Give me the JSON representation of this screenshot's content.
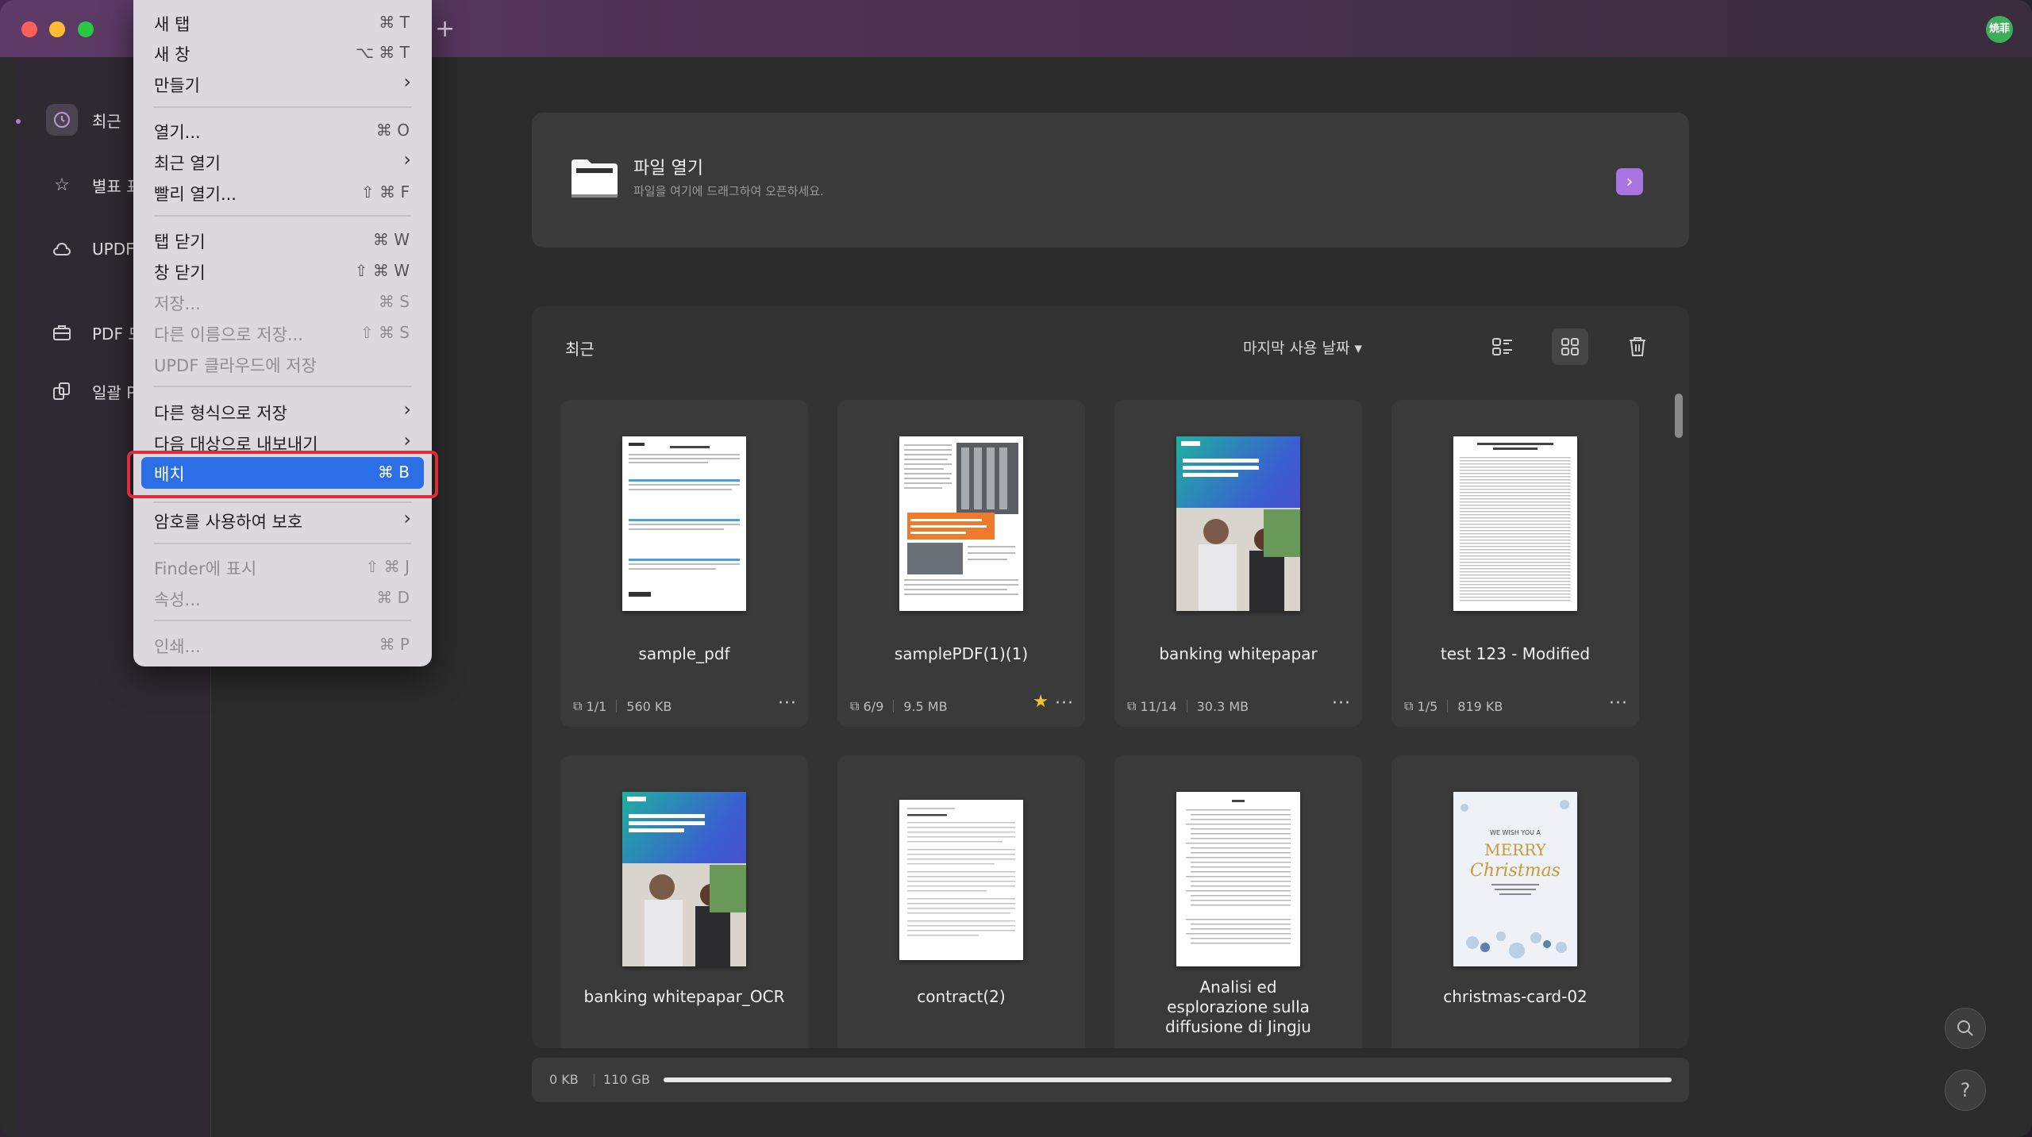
{
  "window": {
    "user_badge": "焼菲"
  },
  "sidebar": {
    "items": [
      {
        "label": "최근",
        "icon": "clock-icon"
      },
      {
        "label": "별표 표",
        "icon": "star-icon"
      },
      {
        "label": "UPDF",
        "icon": "cloud-icon"
      },
      {
        "label": "PDF 도",
        "icon": "briefcase-icon"
      },
      {
        "label": "일괄 P",
        "icon": "batch-icon"
      }
    ]
  },
  "open_file": {
    "title": "파일 열기",
    "subtitle": "파일을 여기에 드래그하여 오픈하세요."
  },
  "recent": {
    "label": "최근",
    "sort_label": "마지막 사용 날짜 ▾",
    "files": [
      {
        "name": "sample_pdf",
        "pages": "1/1",
        "size": "560 KB",
        "starred": false
      },
      {
        "name": "samplePDF(1)(1)",
        "pages": "6/9",
        "size": "9.5 MB",
        "starred": true
      },
      {
        "name": "banking whitepapar",
        "pages": "11/14",
        "size": "30.3 MB",
        "starred": false
      },
      {
        "name": "test 123 - Modified",
        "pages": "1/5",
        "size": "819 KB",
        "starred": false
      },
      {
        "name": "banking whitepapar_OCR"
      },
      {
        "name": "contract(2)"
      },
      {
        "name": "Analisi ed esplorazione sulla diffusione di Jingju"
      },
      {
        "name": "christmas-card-02"
      }
    ]
  },
  "storage": {
    "used": "0 KB",
    "total": "110 GB"
  },
  "menu": {
    "items": [
      {
        "label": "새 탭",
        "shortcut": "⌘ T"
      },
      {
        "label": "새 창",
        "shortcut": "⌥ ⌘ T"
      },
      {
        "label": "만들기",
        "submenu": true
      },
      {
        "label": "열기...",
        "shortcut": "⌘ O"
      },
      {
        "label": "최근 열기",
        "submenu": true
      },
      {
        "label": "빨리 열기...",
        "shortcut": "⇧ ⌘ F"
      },
      {
        "label": "탭 닫기",
        "shortcut": "⌘ W"
      },
      {
        "label": "창 닫기",
        "shortcut": "⇧ ⌘ W"
      },
      {
        "label": "저장...",
        "shortcut": "⌘ S",
        "disabled": true
      },
      {
        "label": "다른 이름으로 저장...",
        "shortcut": "⇧ ⌘ S",
        "disabled": true
      },
      {
        "label": "UPDF 클라우드에 저장",
        "disabled": true
      },
      {
        "label": "다른 형식으로 저장",
        "submenu": true
      },
      {
        "label": "다음 대상으로 내보내기",
        "submenu": true
      },
      {
        "label": "배치",
        "shortcut": "⌘ B",
        "highlighted": true
      },
      {
        "label": "암호를 사용하여 보호",
        "submenu": true
      },
      {
        "label": "Finder에 표시",
        "shortcut": "⇧ ⌘ J",
        "disabled": true
      },
      {
        "label": "속성...",
        "shortcut": "⌘ D",
        "disabled": true
      },
      {
        "label": "인쇄...",
        "shortcut": "⌘ P",
        "disabled": true
      }
    ]
  },
  "thumbs": {
    "t3": "The Most Crucial Strategy for Banks and Financial Institutes in 2022",
    "t8_a": "WE WISH YOU A",
    "t8_b": "MERRY",
    "t8_c": "Christmas"
  },
  "colors": {
    "accent": "#a974e0",
    "highlight": "#2c6ee6",
    "annotation": "#e02b3a"
  }
}
